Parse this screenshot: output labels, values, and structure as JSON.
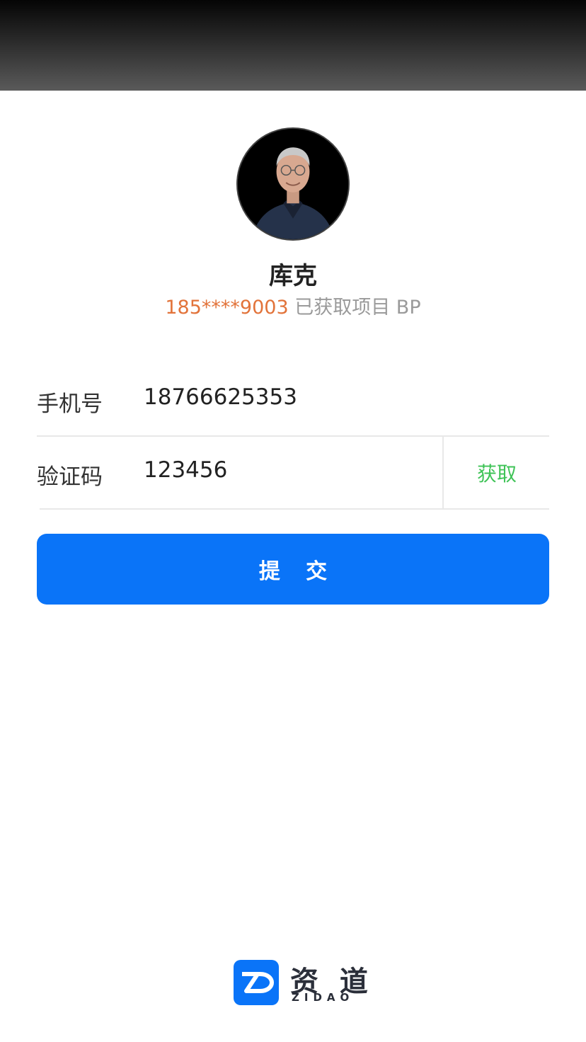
{
  "profile": {
    "name": "库克",
    "phone_masked": "185****9003",
    "status_text": " 已获取项目 BP"
  },
  "form": {
    "phone_label": "手机号",
    "phone_value": "18766625353",
    "code_label": "验证码",
    "code_value": "123456",
    "get_code_label": "获取"
  },
  "submit": {
    "label": "提 交"
  },
  "brand": {
    "name_cn": "资 道",
    "name_en": "ZIDAO"
  },
  "colors": {
    "accent_blue": "#0a74f8",
    "phone_orange": "#e2733a",
    "get_code_green": "#3fc357"
  }
}
